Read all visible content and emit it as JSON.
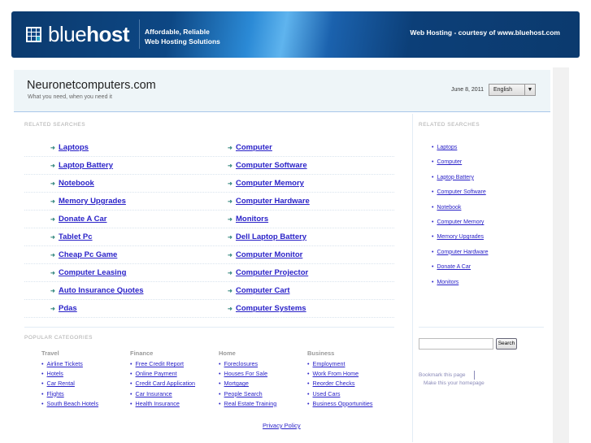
{
  "banner": {
    "logo_light": "blue",
    "logo_bold": "host",
    "tagline1": "Affordable, Reliable",
    "tagline2": "Web Hosting Solutions",
    "courtesy": "Web Hosting - courtesy of www.bluehost.com"
  },
  "header": {
    "site_title": "Neuronetcomputers.com",
    "subtitle": "What you need, when you need it",
    "date": "June 8, 2011",
    "language": "English"
  },
  "related": {
    "heading": "RELATED SEARCHES",
    "rows": [
      [
        "Laptops",
        "Computer"
      ],
      [
        "Laptop Battery",
        "Computer Software"
      ],
      [
        "Notebook",
        "Computer Memory"
      ],
      [
        "Memory Upgrades",
        "Computer Hardware"
      ],
      [
        "Donate A Car",
        "Monitors"
      ],
      [
        "Tablet Pc",
        "Dell Laptop Battery"
      ],
      [
        "Cheap Pc Game",
        "Computer Monitor"
      ],
      [
        "Computer Leasing",
        "Computer Projector"
      ],
      [
        "Auto Insurance Quotes",
        "Computer Cart"
      ],
      [
        "Pdas",
        "Computer Systems"
      ]
    ]
  },
  "sidebar": {
    "heading": "RELATED SEARCHES",
    "links": [
      "Laptops",
      "Computer",
      "Laptop Battery",
      "Computer Software",
      "Notebook",
      "Computer Memory",
      "Memory Upgrades",
      "Computer Hardware",
      "Donate A Car",
      "Monitors"
    ],
    "search_button": "Search",
    "bookmark": "Bookmark this page",
    "homepage": "Make this your homepage"
  },
  "popular": {
    "heading": "POPULAR CATEGORIES",
    "categories": [
      {
        "title": "Travel",
        "links": [
          "Airline Tickets",
          "Hotels",
          "Car Rental",
          "Flights",
          "South Beach Hotels"
        ]
      },
      {
        "title": "Finance",
        "links": [
          "Free Credit Report",
          "Online Payment",
          "Credit Card Application",
          "Car Insurance",
          "Health Insurance"
        ]
      },
      {
        "title": "Home",
        "links": [
          "Foreclosures",
          "Houses For Sale",
          "Mortgage",
          "People Search",
          "Real Estate Training"
        ]
      },
      {
        "title": "Business",
        "links": [
          "Employment",
          "Work From Home",
          "Reorder Checks",
          "Used Cars",
          "Business Opportunities"
        ]
      }
    ]
  },
  "footer": {
    "privacy": "Privacy Policy"
  }
}
